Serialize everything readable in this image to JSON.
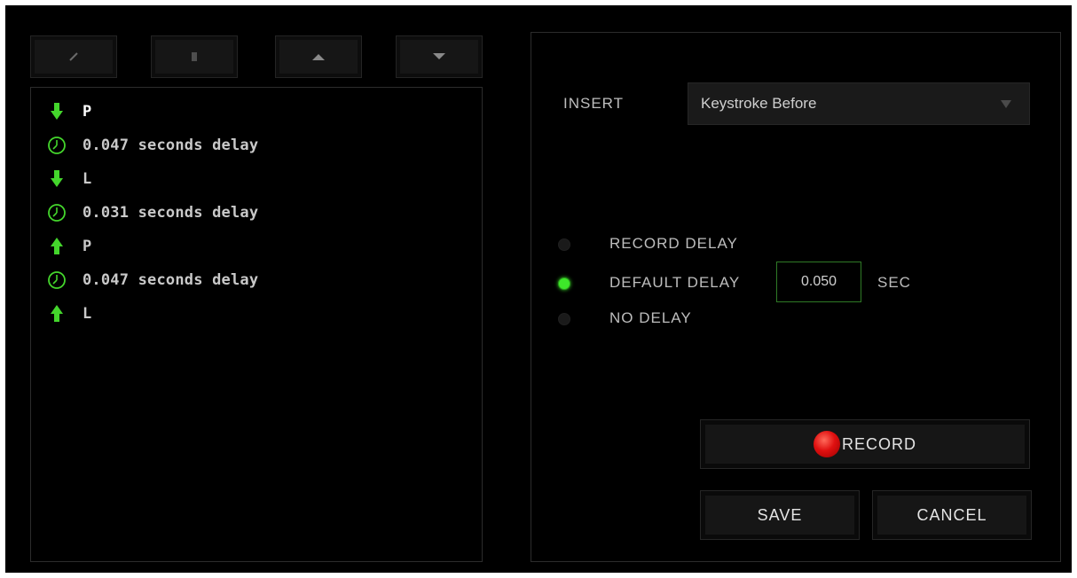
{
  "toolbar": {
    "icons": [
      "pencil-icon",
      "trash-icon",
      "move-up-icon",
      "move-down-icon"
    ]
  },
  "macro_list": [
    {
      "direction": "down",
      "text": "P",
      "icon": "arrow-down-icon",
      "selected": true
    },
    {
      "direction": "delay",
      "text": "0.047 seconds delay",
      "icon": "clock-icon",
      "selected": false
    },
    {
      "direction": "down",
      "text": "L",
      "icon": "arrow-down-icon",
      "selected": false
    },
    {
      "direction": "delay",
      "text": "0.031 seconds delay",
      "icon": "clock-icon",
      "selected": false
    },
    {
      "direction": "up",
      "text": "P",
      "icon": "arrow-up-icon",
      "selected": false
    },
    {
      "direction": "delay",
      "text": "0.047 seconds delay",
      "icon": "clock-icon",
      "selected": false
    },
    {
      "direction": "up",
      "text": "L",
      "icon": "arrow-up-icon",
      "selected": false
    }
  ],
  "insert": {
    "label": "INSERT",
    "selected": "Keystroke Before"
  },
  "delay_options": {
    "record_delay": "RECORD DELAY",
    "default_delay": "DEFAULT DELAY",
    "no_delay": "NO DELAY",
    "selected": "default_delay",
    "default_value": "0.050",
    "unit": "SEC"
  },
  "buttons": {
    "record": "RECORD",
    "save": "SAVE",
    "cancel": "CANCEL"
  },
  "colors": {
    "accent": "#44d62c",
    "selection": "#0f4a0c",
    "record": "#e01010"
  }
}
